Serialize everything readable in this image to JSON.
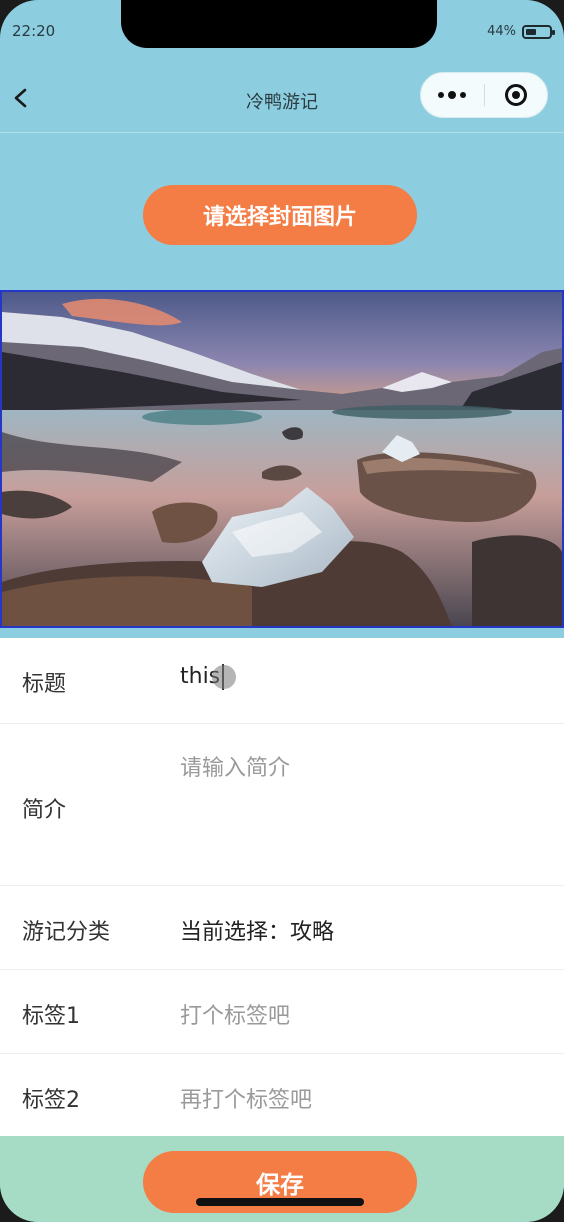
{
  "status_bar": {
    "time": "22:20",
    "battery_percent": "44%",
    "battery_level": 0.44
  },
  "navbar": {
    "title": "冷鸭游记"
  },
  "cover": {
    "button_label": "请选择封面图片"
  },
  "form": {
    "title": {
      "label": "标题",
      "value": "this"
    },
    "intro": {
      "label": "简介",
      "placeholder": "请输入简介"
    },
    "category": {
      "label": "游记分类",
      "value": "当前选择：攻略"
    },
    "tag1": {
      "label": "标签1",
      "placeholder": "打个标签吧"
    },
    "tag2": {
      "label": "标签2",
      "placeholder": "再打个标签吧"
    }
  },
  "footer": {
    "save_label": "保存"
  },
  "colors": {
    "accent": "#f47c45",
    "background": "#8ccde0",
    "footer": "#a6dcc6"
  }
}
